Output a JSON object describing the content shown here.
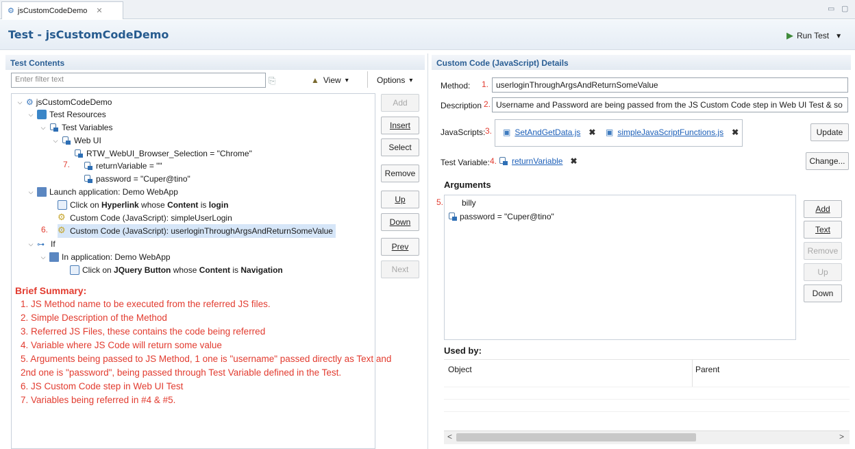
{
  "editor_tab": {
    "label": "jsCustomCodeDemo",
    "close": "✕"
  },
  "window_controls": {
    "minimize": "▭",
    "maximize": "▢"
  },
  "editor_title": "Test - jsCustomCodeDemo",
  "run_test": {
    "label": "Run Test",
    "dropdown": "▾"
  },
  "left": {
    "header": "Test Contents",
    "filter_placeholder": "Enter filter text",
    "view_label": "View",
    "options_label": "Options",
    "tree": [
      {
        "text": "jsCustomCodeDemo"
      },
      {
        "text": "Test Resources"
      },
      {
        "text": "Test Variables"
      },
      {
        "text": "Web UI"
      },
      {
        "text": "RTW_WebUI_Browser_Selection = \"Chrome\""
      },
      {
        "text": "returnVariable = \"\"",
        "marker": "7."
      },
      {
        "text": "password = \"Cuper@tino\""
      },
      {
        "text": "Launch application: Demo WebApp"
      },
      {
        "pre": "Click on ",
        "b1": "Hyperlink",
        "mid": " whose ",
        "b2": "Content",
        "post": " is ",
        "b3": "login"
      },
      {
        "text": "Custom Code (JavaScript): simpleUserLogin"
      },
      {
        "text": "Custom Code (JavaScript): userloginThroughArgsAndReturnSomeValue",
        "marker": "6."
      },
      {
        "text": "If"
      },
      {
        "text": "In application: Demo WebApp"
      },
      {
        "pre": "Click on ",
        "b1": "JQuery Button",
        "mid": " whose ",
        "b2": "Content",
        "post": " is ",
        "b3": "Navigation"
      }
    ],
    "buttons": {
      "add": "Add",
      "insert": "Insert",
      "select": "Select",
      "remove": "Remove",
      "up": "Up",
      "down": "Down",
      "prev": "Prev",
      "next": "Next"
    },
    "summary": {
      "title": "Brief Summary:",
      "items": [
        "1. JS Method name to be executed from the referred JS files.",
        "2. Simple Description of the Method",
        "3. Referred JS Files, these contains the code being referred",
        "4. Variable where JS Code will return some value",
        "5. Arguments being passed to JS Method, 1 one is \"username\" passed directly as Text and",
        "2nd one is \"password\", being passed through Test Variable defined in the Test.",
        "6. JS Custom Code step in Web UI Test",
        "7. Variables being referred in #4 & #5."
      ]
    }
  },
  "right": {
    "header": "Custom Code (JavaScript) Details",
    "method_label": "Method:",
    "method_marker": "1.",
    "method_value": "userloginThroughArgsAndReturnSomeValue",
    "description_label": "Description",
    "description_marker": "2.",
    "description_value": "Username and Password are being passed from the JS Custom Code step in Web UI Test & so",
    "javascripts_label": "JavaScripts:",
    "javascripts_marker": "3.",
    "js_files": [
      "SetAndGetData.js",
      "simpleJavaScriptFunctions.js"
    ],
    "update_btn": "Update",
    "test_variable_label": "Test Variable:",
    "test_variable_marker": "4.",
    "test_variable_value": "returnVariable",
    "change_btn": "Change...",
    "arguments_label": "Arguments",
    "arguments_marker": "5.",
    "arguments": [
      "billy",
      "password = \"Cuper@tino\""
    ],
    "arg_buttons": {
      "add": "Add",
      "text": "Text",
      "remove": "Remove",
      "up": "Up",
      "down": "Down"
    },
    "used_by_label": "Used by:",
    "used_by_columns": [
      "Object",
      "Parent"
    ],
    "scroll_left": "<",
    "scroll_right": ">"
  }
}
